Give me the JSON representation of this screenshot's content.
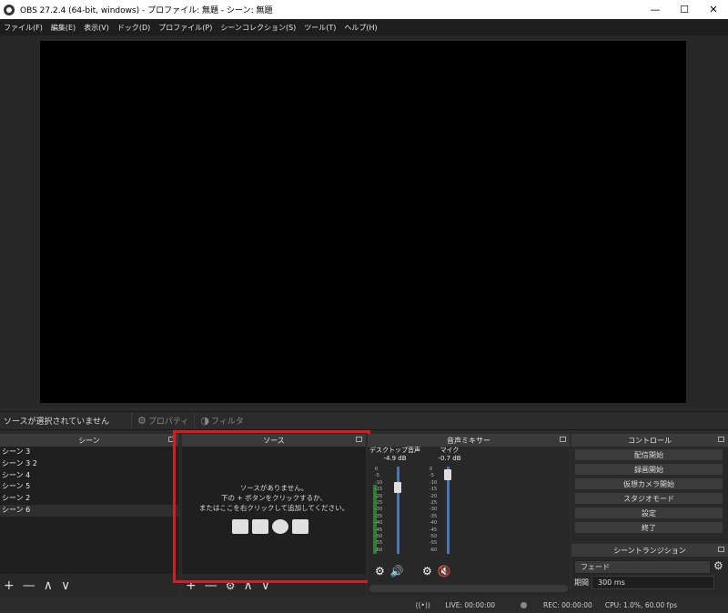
{
  "window": {
    "title": "OBS 27.2.4 (64-bit, windows) - プロファイル: 無題 - シーン: 無題",
    "minimize": "—",
    "maximize": "☐",
    "close": "✕"
  },
  "menu": [
    "ファイル(F)",
    "編集(E)",
    "表示(V)",
    "ドック(D)",
    "プロファイル(P)",
    "シーンコレクション(S)",
    "ツール(T)",
    "ヘルプ(H)"
  ],
  "source_toolbar": {
    "status": "ソースが選択されていません",
    "properties": "プロパティ",
    "filters": "フィルタ"
  },
  "scenes": {
    "title": "シーン",
    "items": [
      "シーン 3",
      "シーン 3 2",
      "シーン 4",
      "シーン 5",
      "シーン 2",
      "シーン 6"
    ],
    "selected_index": 5,
    "toolbar": [
      "+",
      "—",
      "∧",
      "∨"
    ]
  },
  "sources": {
    "title": "ソース",
    "empty_line1": "ソースがありません。",
    "empty_line2": "下の + ボタンをクリックするか、",
    "empty_line3": "またはここを右クリックして追加してください。",
    "toolbar": [
      "+",
      "—",
      "⚙",
      "∧",
      "∨"
    ]
  },
  "mixer": {
    "title": "音声ミキサー",
    "channels": [
      {
        "name": "デスクトップ音声",
        "db": "-4.9 dB",
        "level": 0.8,
        "muted": false
      },
      {
        "name": "マイク",
        "db": "-0.7 dB",
        "level": 0.97,
        "muted": true
      }
    ],
    "scale": [
      "0",
      "-5",
      "-10",
      "-15",
      "-20",
      "-25",
      "-30",
      "-35",
      "-40",
      "-45",
      "-50",
      "-55",
      "-60"
    ]
  },
  "controls": {
    "title": "コントロール",
    "buttons": [
      "配信開始",
      "録画開始",
      "仮想カメラ開始",
      "スタジオモード",
      "設定",
      "終了"
    ]
  },
  "transitions": {
    "title": "シーントランジション",
    "selected": "フェード",
    "duration_label": "期間",
    "duration_value": "300 ms"
  },
  "status": {
    "live": "LIVE: 00:00:00",
    "rec": "REC: 00:00:00",
    "cpu": "CPU: 1.0%, 60.00 fps"
  },
  "colors": {
    "highlight": "#e0181f",
    "fader": "#4a76b8",
    "meter": "#2e7d32",
    "mute": "#d32f2f"
  }
}
